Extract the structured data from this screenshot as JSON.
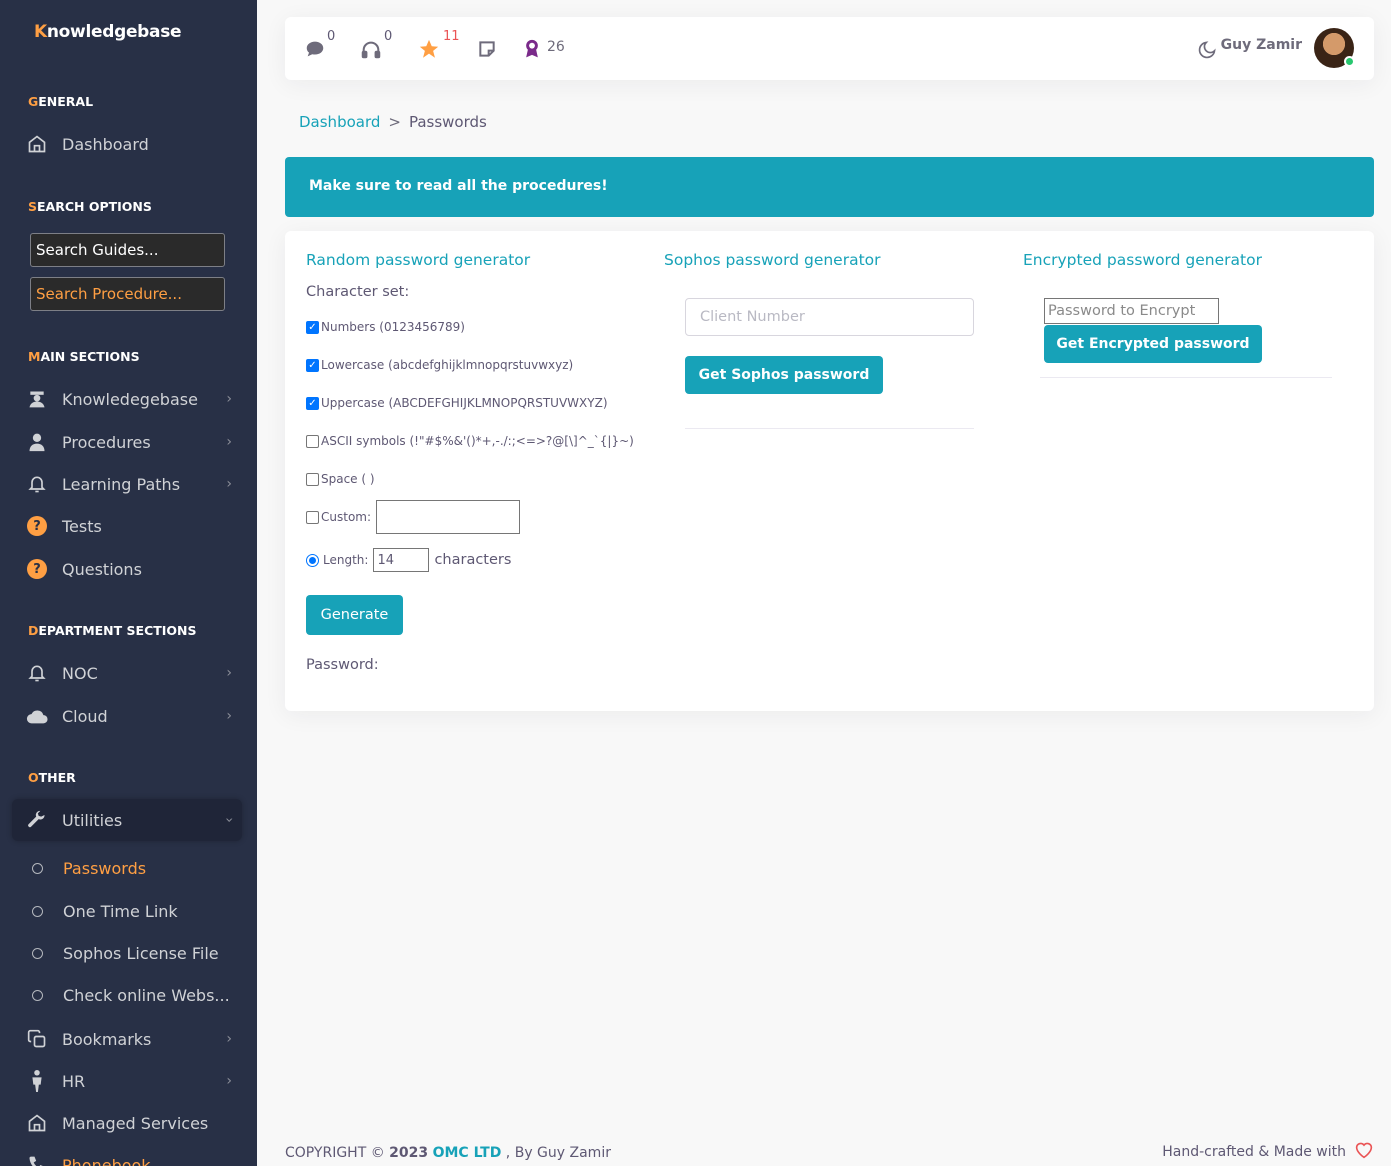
{
  "brand": {
    "first": "K",
    "rest": "nowledgebase"
  },
  "sidebar": {
    "sections": {
      "general": {
        "first": "G",
        "rest": "ENERAL"
      },
      "search": {
        "first": "S",
        "rest": "EARCH OPTIONS"
      },
      "main": {
        "first": "M",
        "rest": "AIN SECTIONS"
      },
      "department": {
        "first": "D",
        "rest": "EPARTMENT SECTIONS"
      },
      "other": {
        "first": "O",
        "rest": "THER"
      }
    },
    "dashboard": "Dashboard",
    "search_guides": "Search Guides...",
    "search_procedures": "Search Procedure...",
    "knowledgebase": "Knowledegebase",
    "procedures": "Procedures",
    "learning_paths": "Learning Paths",
    "tests": "Tests",
    "questions": "Questions",
    "noc": "NOC",
    "cloud": "Cloud",
    "utilities": "Utilities",
    "sub": {
      "passwords": "Passwords",
      "one_time_link": "One Time Link",
      "sophos_license": "Sophos License File",
      "check_online": "Check online Webs..."
    },
    "bookmarks": "Bookmarks",
    "hr": "HR",
    "managed_services": "Managed Services",
    "phonebook": "Phonebook",
    "question_mark": "?"
  },
  "topbar": {
    "chat_count": "0",
    "support_count": "0",
    "star_count": "11",
    "award_count": "26",
    "username": "Guy Zamir"
  },
  "breadcrumb": {
    "home": "Dashboard",
    "sep": ">",
    "current": "Passwords"
  },
  "alert": "Make sure to read all the procedures!",
  "random": {
    "title": "Random password generator",
    "charset_label": "Character set:",
    "numbers": "Numbers (0123456789)",
    "lowercase": "Lowercase (abcdefghijklmnopqrstuvwxyz)",
    "uppercase": "Uppercase (ABCDEFGHIJKLMNOPQRSTUVWXYZ)",
    "ascii": "ASCII symbols (!\"#$%&'()*+,-./:;<=>?@[\\]^_`{|}~)",
    "space": "Space ( )",
    "custom": "Custom:",
    "length_label": "Length:",
    "length_value": "14",
    "characters": "characters",
    "generate": "Generate",
    "password_label": "Password:"
  },
  "sophos": {
    "title": "Sophos password generator",
    "placeholder": "Client Number",
    "button": "Get Sophos password"
  },
  "encrypted": {
    "title": "Encrypted password generator",
    "placeholder": "Password to Encrypt",
    "button": "Get Encrypted password"
  },
  "footer": {
    "copyright": "COPYRIGHT © ",
    "year": "2023",
    "company": "OMC LTD",
    "by": " , By Guy Zamir",
    "made_with": "Hand-crafted & Made with"
  }
}
